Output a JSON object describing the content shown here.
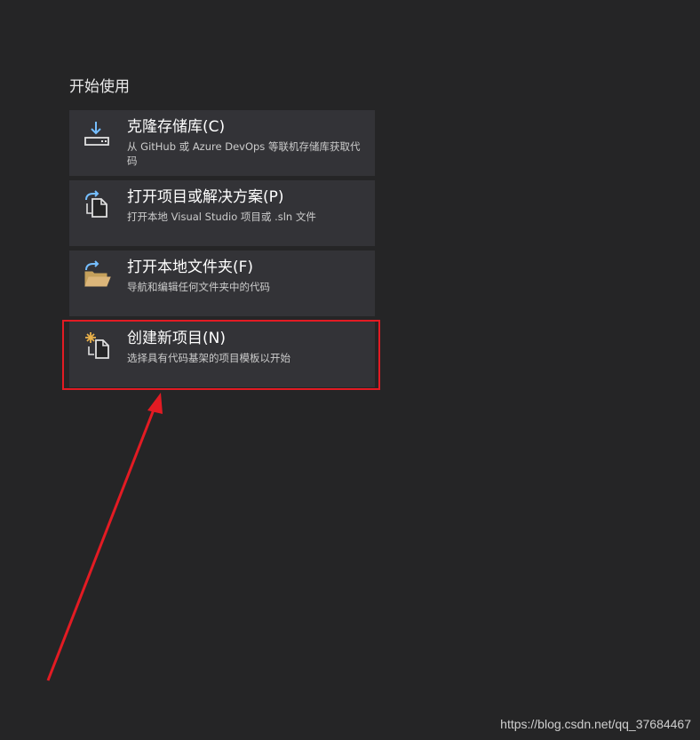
{
  "section": {
    "title": "开始使用"
  },
  "cards": [
    {
      "icon": "clone-download-icon",
      "title": "克隆存储库(C)",
      "desc": "从 GitHub 或 Azure DevOps 等联机存储库获取代码"
    },
    {
      "icon": "open-project-icon",
      "title": "打开项目或解决方案(P)",
      "desc": "打开本地 Visual Studio 项目或 .sln 文件"
    },
    {
      "icon": "open-folder-icon",
      "title": "打开本地文件夹(F)",
      "desc": "导航和编辑任何文件夹中的代码"
    },
    {
      "icon": "new-project-icon",
      "title": "创建新项目(N)",
      "desc": "选择具有代码基架的项目模板以开始"
    }
  ],
  "annotation": {
    "color": "#e31b23"
  },
  "watermark": "https://blog.csdn.net/qq_37684467"
}
